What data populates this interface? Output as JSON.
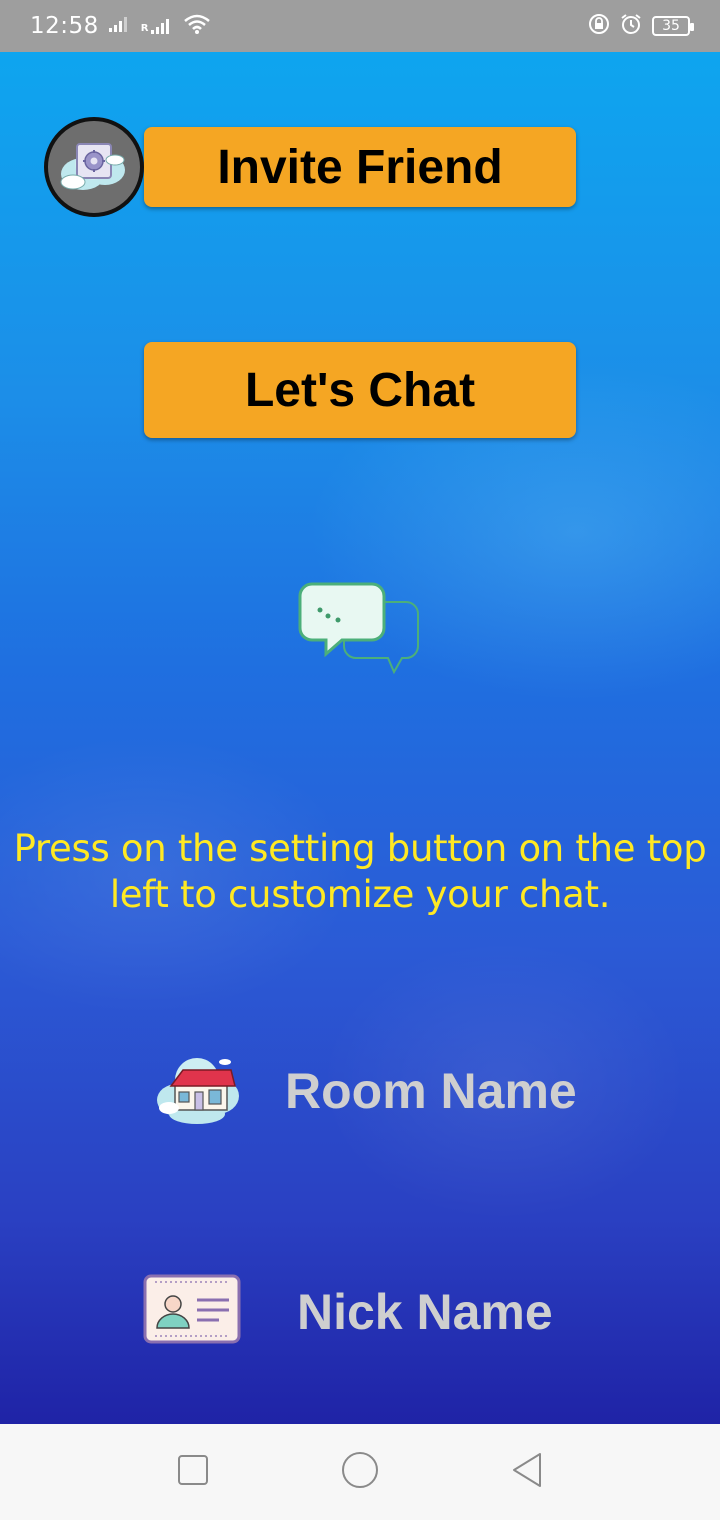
{
  "status_bar": {
    "time": "12:58",
    "roaming_indicator": "R",
    "battery_level": "35",
    "icons": [
      "signal-icon",
      "roaming-signal-icon",
      "wifi-icon",
      "rotation-lock-icon",
      "alarm-icon",
      "battery-icon"
    ]
  },
  "main": {
    "invite_button_label": "Invite Friend",
    "chat_button_label": "Let's Chat",
    "hint_text": "Press on the setting button on the top left to customize your chat.",
    "room_name_label": "Room Name",
    "nick_name_label": "Nick Name",
    "settings_icon": "settings-gear-cloud-icon",
    "chat_icon": "chat-bubbles-icon",
    "room_icon": "house-cloud-icon",
    "nick_icon": "id-card-icon"
  },
  "nav_bar": {
    "items": [
      "recents-square-icon",
      "home-circle-icon",
      "back-triangle-icon"
    ]
  },
  "colors": {
    "button_bg": "#f5a623",
    "hint_text": "#ffe923",
    "field_label": "#cfcfcf",
    "status_bar_bg": "#9e9e9e"
  }
}
